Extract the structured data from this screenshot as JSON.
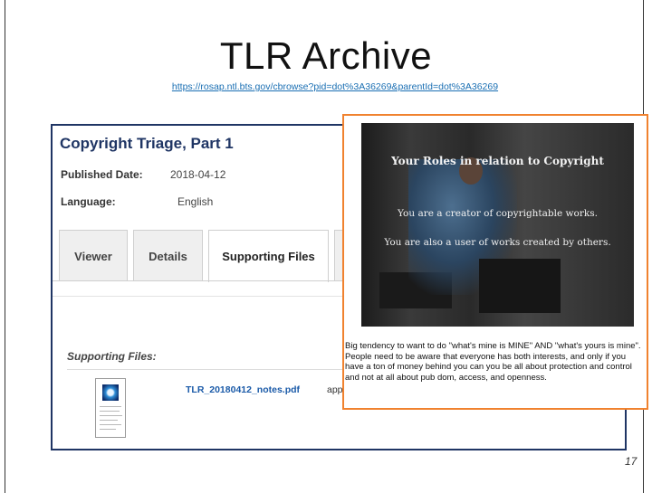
{
  "slide": {
    "title": "TLR Archive",
    "url": "https://rosap.ntl.bts.gov/cbrowse?pid=dot%3A36269&parentId=dot%3A36269",
    "page_number": "17"
  },
  "record": {
    "title": "Copyright Triage, Part 1",
    "published_label": "Published Date:",
    "published_value": "2018-04-12",
    "language_label": "Language:",
    "language_value": "English"
  },
  "tabs": [
    {
      "label": "Viewer",
      "active": false
    },
    {
      "label": "Details",
      "active": false
    },
    {
      "label": "Supporting Files",
      "active": true
    }
  ],
  "supporting_files": {
    "heading": "Supporting Files:",
    "file_name": "TLR_20180412_notes.pdf",
    "mime_partial": "app"
  },
  "popup": {
    "slide_heading": "Your Roles in relation to Copyright",
    "slide_line1": "You are a creator of copyrightable works.",
    "slide_line2": "You are also a user of works created by others.",
    "notes": "Big tendency to want to do \"what's mine is MINE\" AND \"what's yours is mine\". People need to be aware that everyone has both interests, and only if you have a ton of money behind you can you be all about protection and control and not at all about pub dom, access, and openness."
  },
  "colors": {
    "accent_navy": "#1f3564",
    "link_blue": "#1a5aa8",
    "popup_border": "#f0822f"
  }
}
